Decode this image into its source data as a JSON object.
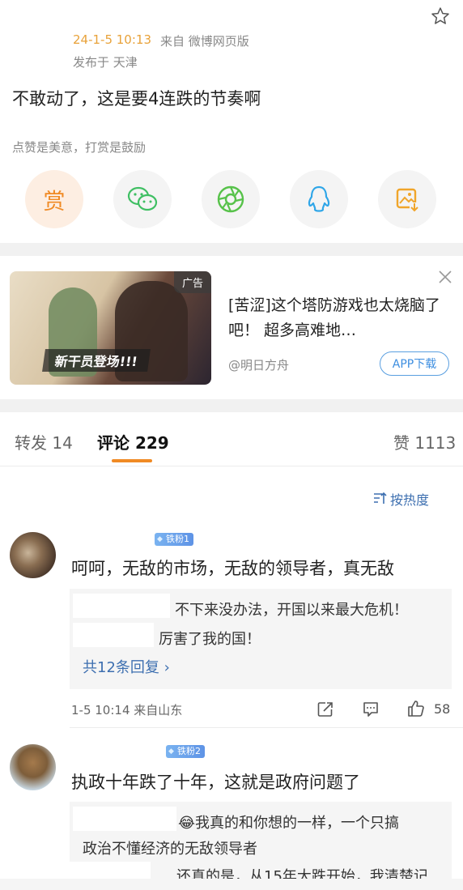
{
  "post": {
    "time": "24-1-5 10:13",
    "source": "来自 微博网页版",
    "location": "发布于 天津",
    "text": "不敢动了，这是要4连跌的节奏啊",
    "reward_tip": "点赞是美意，打赏是鼓励",
    "reward_glyph": "赏",
    "share_icons": [
      "reward-icon",
      "wechat-icon",
      "moments-icon",
      "qq-icon",
      "save-image-icon"
    ]
  },
  "ad": {
    "badge": "广告",
    "banner": "新干员登场!!!",
    "title": "[苦涩]这个塔防游戏也太烧脑了吧！ 超多高难地…",
    "author": "@明日方舟",
    "button": "APP下载"
  },
  "tabs": {
    "repost": "转发 14",
    "comments": "评论 229",
    "likes": "赞 1113"
  },
  "sort_label": "按热度",
  "comments": [
    {
      "badge": "铁粉1",
      "text": "呵呵，无敌的市场，无敌的领导者，真无敌",
      "replies": [
        "不下来没办法，开国以来最大危机！",
        "厉害了我的国！"
      ],
      "more": "共12条回复 ›",
      "time_source": "1-5 10:14  来自山东",
      "likes": "58"
    },
    {
      "badge": "铁粉2",
      "text": "执政十年跌了十年，这就是政府问题了",
      "replies": [
        "😂我真的和你想的一样，一个只搞",
        "政治不懂经济的无敌领导者",
        "还真的是，从15年大跌开始，我清楚记"
      ]
    }
  ],
  "colors": {
    "accent": "#f08a24",
    "link": "#3d6fb0",
    "time": "#e8a23a"
  }
}
